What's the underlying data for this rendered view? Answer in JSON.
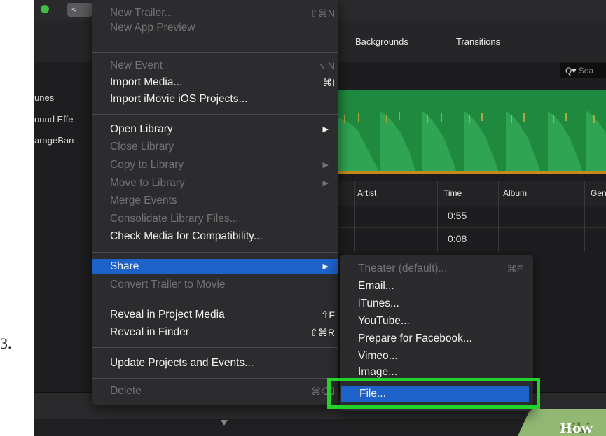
{
  "step_number": "3.",
  "app": {
    "back_label": "<"
  },
  "tabs": [
    "Backgrounds",
    "Transitions"
  ],
  "search": {
    "glyph": "Q▾",
    "text": "Sea"
  },
  "sidebar": {
    "items": [
      "unes",
      "ound Effe",
      "arageBan"
    ]
  },
  "table": {
    "headers": [
      "Artist",
      "Time",
      "Album",
      "Gen"
    ],
    "rows": [
      {
        "time": "0:55"
      },
      {
        "time": "0:08"
      }
    ]
  },
  "file_menu": {
    "items": [
      {
        "label": "New Trailer...",
        "shortcut": "⇧⌘N",
        "enabled": false
      },
      {
        "label": "New App Preview",
        "shortcut": "",
        "enabled": false
      },
      {
        "label": "New Event",
        "shortcut": "⌥N",
        "enabled": false
      },
      {
        "label": "Import Media...",
        "shortcut": "⌘I",
        "enabled": true
      },
      {
        "label": "Import iMovie iOS Projects...",
        "shortcut": "",
        "enabled": true
      },
      {
        "label": "Open Library",
        "shortcut": "▶",
        "enabled": true
      },
      {
        "label": "Close Library",
        "shortcut": "",
        "enabled": false
      },
      {
        "label": "Copy to Library",
        "shortcut": "▶",
        "enabled": false
      },
      {
        "label": "Move to Library",
        "shortcut": "▶",
        "enabled": false
      },
      {
        "label": "Merge Events",
        "shortcut": "",
        "enabled": false
      },
      {
        "label": "Consolidate Library Files...",
        "shortcut": "",
        "enabled": false
      },
      {
        "label": "Check Media for Compatibility...",
        "shortcut": "",
        "enabled": true
      },
      {
        "label": "Share",
        "shortcut": "▶",
        "enabled": true,
        "highlighted": true
      },
      {
        "label": "Convert Trailer to Movie",
        "shortcut": "",
        "enabled": false
      },
      {
        "label": "Reveal in Project Media",
        "shortcut": "⇧F",
        "enabled": true
      },
      {
        "label": "Reveal in Finder",
        "shortcut": "⇧⌘R",
        "enabled": true
      },
      {
        "label": "Update Projects and Events...",
        "shortcut": "",
        "enabled": true
      },
      {
        "label": "Delete",
        "shortcut": "⌘⌫",
        "enabled": false
      }
    ]
  },
  "share_submenu": {
    "items": [
      {
        "label": "Theater (default)...",
        "shortcut": "⌘E",
        "enabled": false
      },
      {
        "label": "Email...",
        "enabled": true
      },
      {
        "label": "iTunes...",
        "enabled": true
      },
      {
        "label": "YouTube...",
        "enabled": true
      },
      {
        "label": "Prepare for Facebook...",
        "enabled": true
      },
      {
        "label": "Vimeo...",
        "enabled": true
      },
      {
        "label": "Image...",
        "enabled": true
      },
      {
        "label": "File...",
        "enabled": true,
        "highlighted": true
      }
    ]
  },
  "watermark": {
    "wiki": "wiki",
    "how": "How"
  },
  "colors": {
    "menu_highlight": "#1d62c9",
    "callout_green": "#22d22a",
    "waveform_green": "#1f8a3f"
  }
}
